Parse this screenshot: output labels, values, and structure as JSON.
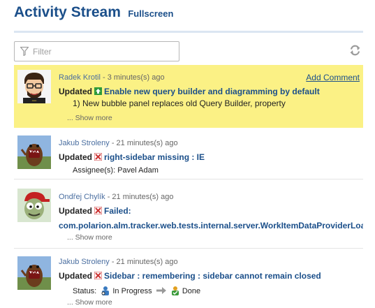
{
  "header": {
    "title": "Activity Stream",
    "fullscreen_label": "Fullscreen"
  },
  "filter": {
    "placeholder": "Filter"
  },
  "icons": {
    "filter": "funnel-icon",
    "refresh": "refresh-icon"
  },
  "colors": {
    "accent": "#1b4f8a",
    "highlight": "#fbf185",
    "defect": "#cc3333",
    "improvement": "#2e9a3a"
  },
  "entries": [
    {
      "author": "Radek Krotil",
      "time": " - 3 minutes(s) ago",
      "add_comment": "Add Comment",
      "action": "Updated",
      "item_type": "improvement",
      "item_title": "Enable new query builder and diagramming by default",
      "description": "1) New bubble panel replaces old Query Builder, property",
      "show_more": "Show more"
    },
    {
      "author": "Jakub Stroleny",
      "time": " - 21 minutes(s) ago",
      "action": "Updated",
      "item_type": "defect",
      "item_title": "right-sidebar missing : IE",
      "detail": "Assignee(s): Pavel Adam"
    },
    {
      "author": "Ondřej Chylík",
      "time": " - 21 minutes(s) ago",
      "action": "Updated",
      "item_type": "defect",
      "item_title": "Failed:",
      "item_title_cont": "com.polarion.alm.tracker.web.tests.internal.server.WorkItemDataProviderLoad",
      "show_more": "Show more"
    },
    {
      "author": "Jakub Stroleny",
      "time": " - 21 minutes(s) ago",
      "action": "Updated",
      "item_type": "defect",
      "item_title": "Sidebar : remembering : sidebar cannot remain closed",
      "status_label": "Status:",
      "status_from": "In Progress",
      "status_to": "Done",
      "show_more": "Show more"
    }
  ]
}
